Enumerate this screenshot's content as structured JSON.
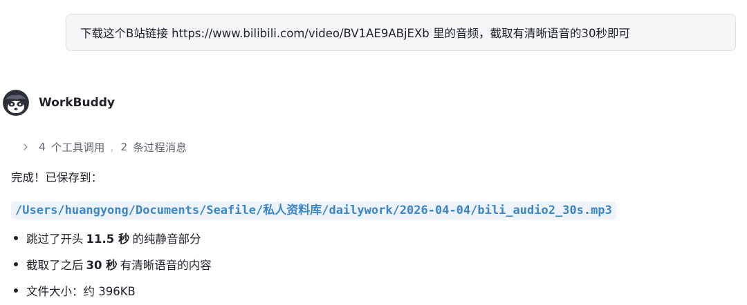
{
  "user_message": {
    "text": "下载这个B站链接 https://www.bilibili.com/video/BV1AE9ABjEXb 里的音频，截取有清晰语音的30秒即可"
  },
  "agent": {
    "name": "WorkBuddy",
    "avatar_icon": "raccoon-avatar-icon"
  },
  "tool_summary": {
    "tool_count": "4",
    "tool_label": "个工具调用",
    "separator": ",",
    "process_count": "2",
    "process_label": "条过程消息"
  },
  "response": {
    "done_text": "完成！已保存到：",
    "file_path": "/Users/huangyong/Documents/Seafile/私人资料库/dailywork/2026-04-04/bili_audio2_30s.mp3",
    "bullets": [
      {
        "pre": "跳过了开头",
        "bold": "11.5 秒",
        "post": "的纯静音部分"
      },
      {
        "pre": "截取了之后",
        "bold": "30 秒",
        "post": "有清晰语音的内容"
      },
      {
        "pre": "文件大小：约 396KB",
        "bold": "",
        "post": ""
      }
    ]
  },
  "colors": {
    "link_code": "#3a86c8",
    "code_bg": "#eef3f9",
    "bubble_bg": "#f5f6f8",
    "muted_text": "#646a73"
  }
}
